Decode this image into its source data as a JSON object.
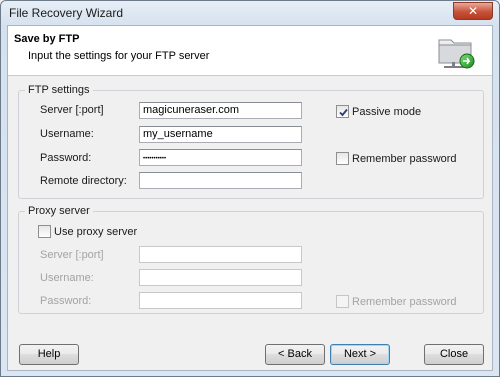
{
  "window": {
    "title": "File Recovery Wizard",
    "close_glyph": "✕"
  },
  "header": {
    "title": "Save by FTP",
    "subtitle": "Input the settings for your FTP server",
    "icon": "folder-network-icon"
  },
  "ftp": {
    "legend": "FTP settings",
    "server_label": "Server [:port]",
    "server_value": "magicuneraser.com",
    "username_label": "Username:",
    "username_value": "my_username",
    "password_label": "Password:",
    "password_value": "•••••••••••",
    "remote_dir_label": "Remote directory:",
    "remote_dir_value": "",
    "passive_label": "Passive mode",
    "passive_checked": true,
    "remember_label": "Remember password",
    "remember_checked": false
  },
  "proxy": {
    "legend": "Proxy server",
    "use_proxy_label": "Use proxy server",
    "use_proxy_checked": false,
    "server_label": "Server [:port]",
    "username_label": "Username:",
    "password_label": "Password:",
    "remember_label": "Remember password"
  },
  "buttons": {
    "help": "Help",
    "back": "< Back",
    "next": "Next >",
    "close": "Close"
  }
}
